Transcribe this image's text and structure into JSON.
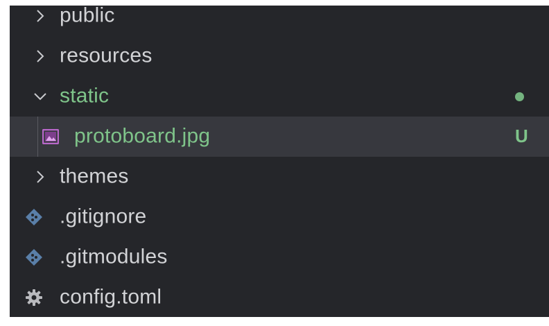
{
  "explorer": {
    "items": [
      {
        "label": "public",
        "kind": "folder",
        "expanded": false
      },
      {
        "label": "resources",
        "kind": "folder",
        "expanded": false
      },
      {
        "label": "static",
        "kind": "folder",
        "expanded": true,
        "status_dot_color": "#74b37f"
      },
      {
        "label": "protoboard.jpg",
        "kind": "image-file",
        "status": "U",
        "selected": true
      },
      {
        "label": "themes",
        "kind": "folder",
        "expanded": false
      },
      {
        "label": ".gitignore",
        "kind": "git-file"
      },
      {
        "label": ".gitmodules",
        "kind": "git-file"
      },
      {
        "label": "config.toml",
        "kind": "config-file"
      }
    ]
  },
  "colors": {
    "background": "#25262a",
    "selected_row": "#37383e",
    "text": "#d2d3d6",
    "git_untracked": "#7fc48a",
    "git_icon": "#5a7fa8",
    "image_icon": "#b867c9"
  },
  "icons": {
    "collapsed": "chevron-right-icon",
    "expanded": "chevron-down-icon",
    "image": "image-file-icon",
    "git": "git-file-icon",
    "config": "gear-icon"
  }
}
